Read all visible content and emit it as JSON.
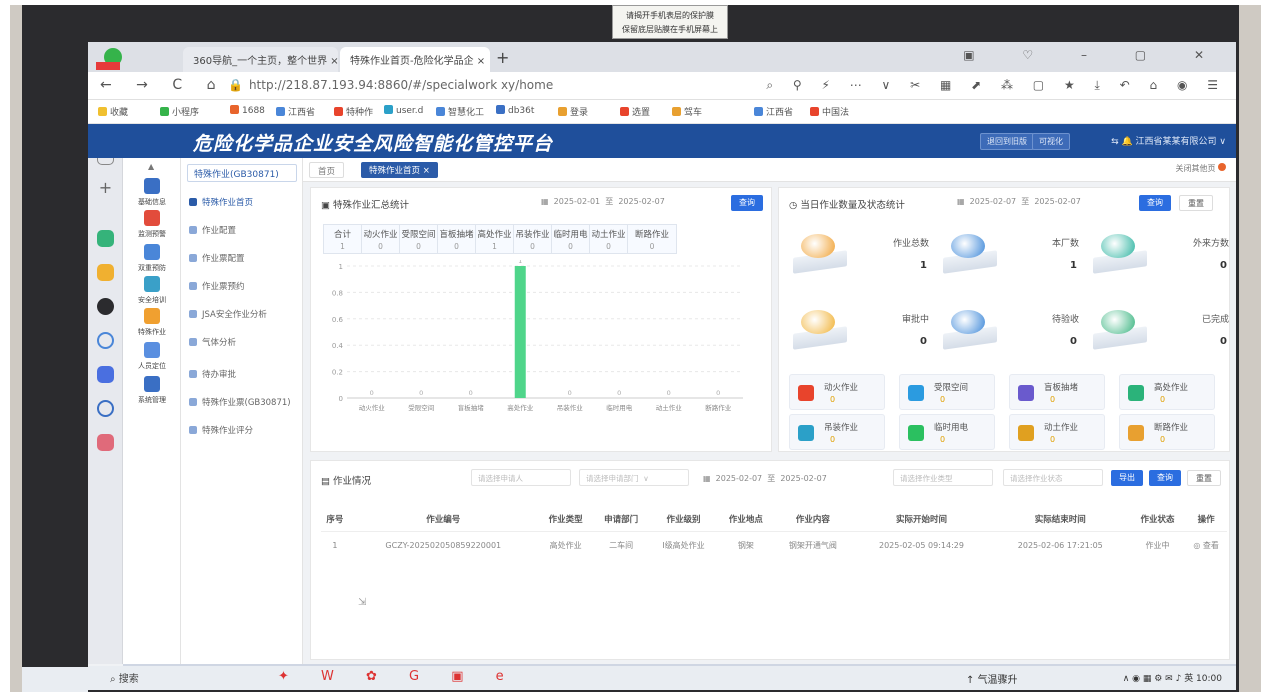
{
  "sticker": {
    "line1": "请揭开手机表层的保护膜",
    "line2": "保留底层贴膜在手机屏幕上"
  },
  "browser": {
    "tabs": [
      {
        "label": "360导航_一个主页，整个世界"
      },
      {
        "label": "特殊作业首页-危险化学品企"
      }
    ],
    "url": "http://218.87.193.94:8860/#/specialwork xy/home",
    "bookmarks": [
      "收藏",
      "小程序",
      "1688",
      "江西省",
      "特种作",
      "user.d",
      "智慧化工",
      "db36t",
      "登录",
      "选置",
      "驾车",
      "江西省",
      "中国法"
    ],
    "taskbar_search": "搜索",
    "weather": "气温骤升",
    "tray": "英 10:00"
  },
  "app": {
    "title": "危险化学品企业安全风险智能化管控平台",
    "header_btn1": "退回到旧版",
    "header_btn2": "可视化",
    "user": "江西省某某有限公司"
  },
  "rail": [
    {
      "label": "基础信息",
      "color": "#3a6fc4"
    },
    {
      "label": "监测预警",
      "color": "#e24c3c"
    },
    {
      "label": "双重预防",
      "color": "#4a86d8"
    },
    {
      "label": "安全培训",
      "color": "#3aa0c8"
    },
    {
      "label": "特殊作业",
      "color": "#f0a030"
    },
    {
      "label": "人员定位",
      "color": "#5a8fe0"
    },
    {
      "label": "系统管理",
      "color": "#3a6fc4"
    }
  ],
  "menu": {
    "head": "特殊作业(GB30871)",
    "items": [
      "特殊作业首页",
      "作业配置",
      "作业票配置",
      "作业票预约",
      "JSA安全作业分析",
      "气体分析",
      "待办审批",
      "特殊作业票(GB30871)",
      "特殊作业评分"
    ]
  },
  "page_tabs": {
    "home": "首页",
    "current": "特殊作业首页",
    "right": "关闭其他页"
  },
  "summary": {
    "title": "特殊作业汇总统计",
    "date_from": "2025-02-01",
    "date_sep": "至",
    "date_to": "2025-02-07",
    "query": "查询",
    "stats": [
      {
        "name": "合计",
        "value": "1"
      },
      {
        "name": "动火作业",
        "value": "0"
      },
      {
        "name": "受限空间",
        "value": "0"
      },
      {
        "name": "盲板抽堵",
        "value": "0"
      },
      {
        "name": "高处作业",
        "value": "1"
      },
      {
        "name": "吊装作业",
        "value": "0"
      },
      {
        "name": "临时用电",
        "value": "0"
      },
      {
        "name": "动土作业",
        "value": "0"
      },
      {
        "name": "断路作业",
        "value": "0"
      }
    ]
  },
  "chart_data": {
    "type": "bar",
    "categories": [
      "动火作业",
      "受限空间",
      "盲板抽堵",
      "高处作业",
      "吊装作业",
      "临时用电",
      "动土作业",
      "断路作业"
    ],
    "values": [
      0,
      0,
      0,
      1,
      0,
      0,
      0,
      0
    ],
    "yticks": [
      "0",
      "0.2",
      "0.4",
      "0.6",
      "0.8",
      "1"
    ],
    "ylim": [
      0,
      1
    ],
    "bar_color": "#4fd58a",
    "grid": true
  },
  "today": {
    "title": "当日作业数量及状态统计",
    "date_from": "2025-02-07",
    "date_sep": "至",
    "date_to": "2025-02-07",
    "query": "查询",
    "reset": "重置",
    "status_cards": [
      {
        "label": "作业总数",
        "value": "1",
        "color": "#f0a030"
      },
      {
        "label": "本厂数",
        "value": "1",
        "color": "#3a86d8"
      },
      {
        "label": "外来方数",
        "value": "0",
        "color": "#2bb3a0"
      },
      {
        "label": "审批中",
        "value": "0",
        "color": "#f0b030"
      },
      {
        "label": "待验收",
        "value": "0",
        "color": "#3a86d8"
      },
      {
        "label": "已完成",
        "value": "0",
        "color": "#36b37e"
      }
    ],
    "type_cards": [
      {
        "name": "动火作业",
        "value": "0",
        "color": "#e8442c"
      },
      {
        "name": "受限空间",
        "value": "0",
        "color": "#2b9be0"
      },
      {
        "name": "盲板抽堵",
        "value": "0",
        "color": "#6a5acd"
      },
      {
        "name": "高处作业",
        "value": "0",
        "color": "#2bb37a"
      },
      {
        "name": "吊装作业",
        "value": "0",
        "color": "#2ba0c8"
      },
      {
        "name": "临时用电",
        "value": "0",
        "color": "#2bc060"
      },
      {
        "name": "动土作业",
        "value": "0",
        "color": "#e0a020"
      },
      {
        "name": "断路作业",
        "value": "0",
        "color": "#e8a030"
      }
    ]
  },
  "work": {
    "title": "作业情况",
    "ph_applicant": "请选择申请人",
    "ph_dept": "请选择申请部门",
    "date_from": "2025-02-07",
    "date_sep": "至",
    "date_to": "2025-02-07",
    "ph_extra1": "请选择作业类型",
    "ph_extra2": "请选择作业状态",
    "export": "导出",
    "query": "查询",
    "reset": "重置",
    "columns": [
      "序号",
      "作业编号",
      "作业类型",
      "申请部门",
      "作业级别",
      "作业地点",
      "作业内容",
      "实际开始时间",
      "实际结束时间",
      "作业状态",
      "操作"
    ],
    "rows": [
      [
        "1",
        "GCZY-202502050859220001",
        "高处作业",
        "二车间",
        "Ⅰ级高处作业",
        "钢架",
        "钢架开通气阀",
        "2025-02-05 09:14:29",
        "2025-02-06 17:21:05",
        "作业中",
        "查看"
      ]
    ]
  }
}
